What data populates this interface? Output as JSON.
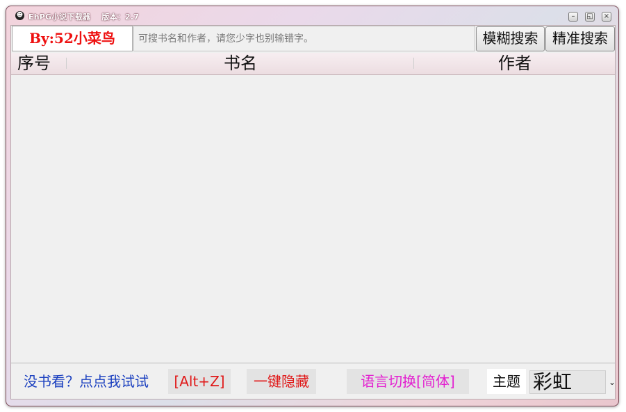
{
  "window": {
    "title": "EhPG小说下载器",
    "version": "版本：2.7",
    "controls": [
      "–",
      "◱",
      "×"
    ]
  },
  "search": {
    "brand": "By:52小菜鸟",
    "placeholder": "可搜书名和作者，请您少字也别输错字。",
    "fuzzy_label": "模糊搜索",
    "exact_label": "精准搜索"
  },
  "table": {
    "columns": [
      "序号",
      "书名",
      "作者"
    ],
    "rows": []
  },
  "footer": {
    "try_link": "没书看？点点我试试",
    "hotkey": "[Alt+Z]",
    "hide_label": "一键隐藏",
    "lang_label": "语言切换[简体]",
    "theme_label": "主题",
    "theme_value": "彩虹"
  },
  "colors": {
    "brand_red": "#ee1010",
    "link_blue": "#1a3fbf",
    "lang_magenta": "#e31ed0"
  }
}
